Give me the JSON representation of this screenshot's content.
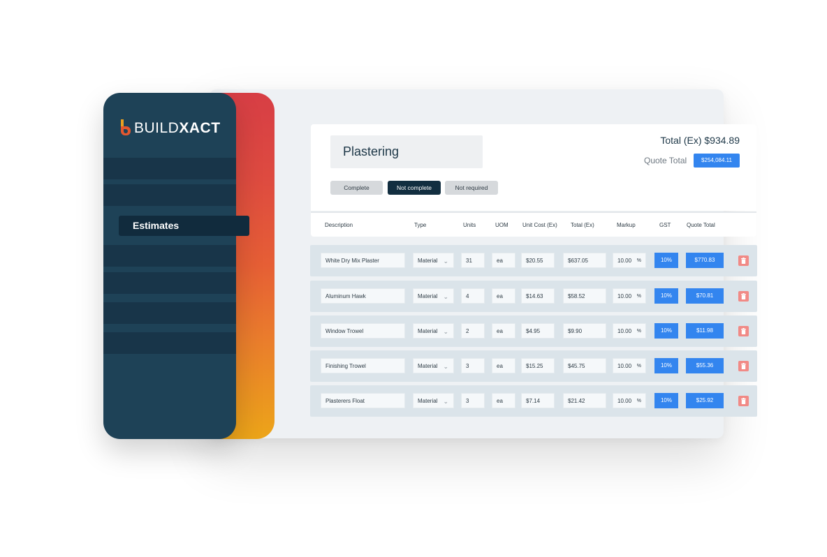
{
  "brand": {
    "name_part1": "BUILD",
    "name_part2": "XACT",
    "colors": {
      "sidebar": "#1e4257",
      "accent_start": "#d73e45",
      "accent_end": "#eca519",
      "primary_blue": "#3385ef",
      "delete": "#f18a86"
    }
  },
  "sidebar": {
    "active_item": "Estimates"
  },
  "header": {
    "title": "Plastering",
    "total_ex": "Total (Ex) $934.89",
    "quote_total_label": "Quote Total",
    "quote_total_value": "$254,084.11",
    "status_buttons": {
      "complete": "Complete",
      "not_complete": "Not complete",
      "not_required": "Not required"
    }
  },
  "table": {
    "columns": {
      "description": "Description",
      "type": "Type",
      "units": "Units",
      "uom": "UOM",
      "unit_cost": "Unit Cost (Ex)",
      "total": "Total (Ex)",
      "markup": "Markup",
      "gst": "GST",
      "quote_total": "Quote Total"
    },
    "rows": [
      {
        "description": "White Dry Mix Plaster",
        "type": "Material",
        "units": "31",
        "uom": "ea",
        "unit_cost": "$20.55",
        "total": "$637.05",
        "markup": "10.00",
        "markup_unit": "%",
        "gst": "10%",
        "quote_total": "$770.83"
      },
      {
        "description": "Aluminum Hawk",
        "type": "Material",
        "units": "4",
        "uom": "ea",
        "unit_cost": "$14.63",
        "total": "$58.52",
        "markup": "10.00",
        "markup_unit": "%",
        "gst": "10%",
        "quote_total": "$70.81"
      },
      {
        "description": "Window Trowel",
        "type": "Material",
        "units": "2",
        "uom": "ea",
        "unit_cost": "$4.95",
        "total": "$9.90",
        "markup": "10.00",
        "markup_unit": "%",
        "gst": "10%",
        "quote_total": "$11.98"
      },
      {
        "description": "Finishing Trowel",
        "type": "Material",
        "units": "3",
        "uom": "ea",
        "unit_cost": "$15.25",
        "total": "$45.75",
        "markup": "10.00",
        "markup_unit": "%",
        "gst": "10%",
        "quote_total": "$55.36"
      },
      {
        "description": "Plasterers Float",
        "type": "Material",
        "units": "3",
        "uom": "ea",
        "unit_cost": "$7.14",
        "total": "$21.42",
        "markup": "10.00",
        "markup_unit": "%",
        "gst": "10%",
        "quote_total": "$25.92"
      }
    ]
  }
}
